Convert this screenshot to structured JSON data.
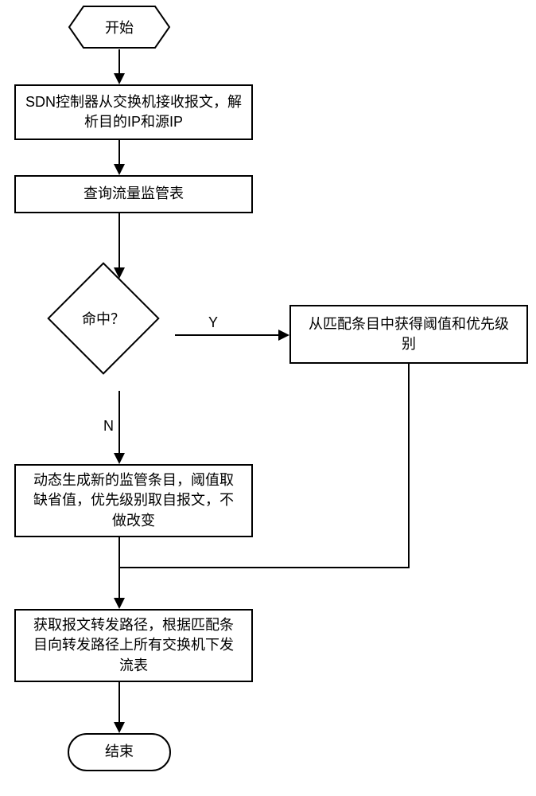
{
  "flowchart": {
    "start": "开始",
    "step1": "SDN控制器从交换机接收报文，解\n析目的IP和源IP",
    "step2": "查询流量监管表",
    "decision": "命中？",
    "branch_yes": "Y",
    "branch_no": "N",
    "step_yes": "从匹配条目中获得阈值和优先级\n别",
    "step_no": "动态生成新的监管条目，阈值取\n缺省值，优先级别取自报文，不\n做改变",
    "step_final": "获取报文转发路径，根据匹配条\n目向转发路径上所有交换机下发\n流表",
    "end": "结束"
  }
}
